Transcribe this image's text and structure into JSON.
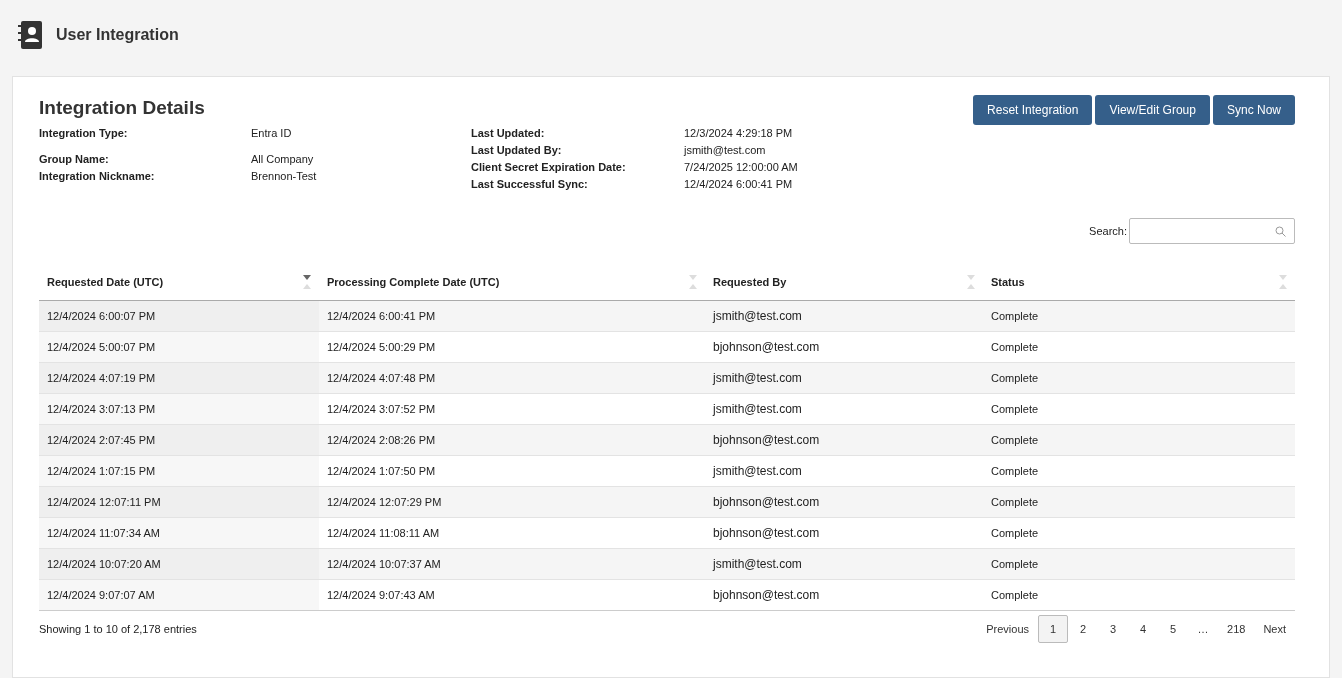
{
  "page": {
    "title": "User Integration"
  },
  "details": {
    "title": "Integration Details",
    "left": [
      {
        "label": "Integration Type:",
        "value": "Entra ID"
      },
      {
        "label": "Group Name:",
        "value": "All Company"
      },
      {
        "label": "Integration Nickname:",
        "value": "Brennon-Test"
      }
    ],
    "right": [
      {
        "label": "Last Updated:",
        "value": "12/3/2024 4:29:18 PM"
      },
      {
        "label": "Last Updated By:",
        "value": "jsmith@test.com"
      },
      {
        "label": "Client Secret Expiration Date:",
        "value": "7/24/2025 12:00:00 AM"
      },
      {
        "label": "Last Successful Sync:",
        "value": "12/4/2024 6:00:41 PM"
      }
    ]
  },
  "buttons": [
    "Reset Integration",
    "View/Edit Group",
    "Sync Now"
  ],
  "search": {
    "label": "Search:"
  },
  "table": {
    "columns": [
      {
        "label": "Requested Date (UTC)",
        "sorted": true
      },
      {
        "label": "Processing Complete Date (UTC)",
        "sorted": false
      },
      {
        "label": "Requested By",
        "sorted": false
      },
      {
        "label": "Status",
        "sorted": false
      }
    ],
    "rows": [
      [
        "12/4/2024 6:00:07 PM",
        "12/4/2024 6:00:41 PM",
        "jsmith@test.com",
        "Complete"
      ],
      [
        "12/4/2024 5:00:07 PM",
        "12/4/2024 5:00:29 PM",
        "bjohnson@test.com",
        "Complete"
      ],
      [
        "12/4/2024 4:07:19 PM",
        "12/4/2024 4:07:48 PM",
        "jsmith@test.com",
        "Complete"
      ],
      [
        "12/4/2024 3:07:13 PM",
        "12/4/2024 3:07:52 PM",
        "jsmith@test.com",
        "Complete"
      ],
      [
        "12/4/2024 2:07:45 PM",
        "12/4/2024 2:08:26 PM",
        "bjohnson@test.com",
        "Complete"
      ],
      [
        "12/4/2024 1:07:15 PM",
        "12/4/2024 1:07:50 PM",
        "jsmith@test.com",
        "Complete"
      ],
      [
        "12/4/2024 12:07:11 PM",
        "12/4/2024 12:07:29 PM",
        "bjohnson@test.com",
        "Complete"
      ],
      [
        "12/4/2024 11:07:34 AM",
        "12/4/2024 11:08:11 AM",
        "bjohnson@test.com",
        "Complete"
      ],
      [
        "12/4/2024 10:07:20 AM",
        "12/4/2024 10:07:37 AM",
        "jsmith@test.com",
        "Complete"
      ],
      [
        "12/4/2024 9:07:07 AM",
        "12/4/2024 9:07:43 AM",
        "bjohnson@test.com",
        "Complete"
      ]
    ]
  },
  "footer": {
    "summary": "Showing 1 to 10 of 2,178 entries",
    "pagination": [
      {
        "label": "Previous",
        "selected": false
      },
      {
        "label": "1",
        "selected": true
      },
      {
        "label": "2",
        "selected": false
      },
      {
        "label": "3",
        "selected": false
      },
      {
        "label": "4",
        "selected": false
      },
      {
        "label": "5",
        "selected": false
      },
      {
        "label": "…",
        "selected": false
      },
      {
        "label": "218",
        "selected": false
      },
      {
        "label": "Next",
        "selected": false
      }
    ]
  }
}
